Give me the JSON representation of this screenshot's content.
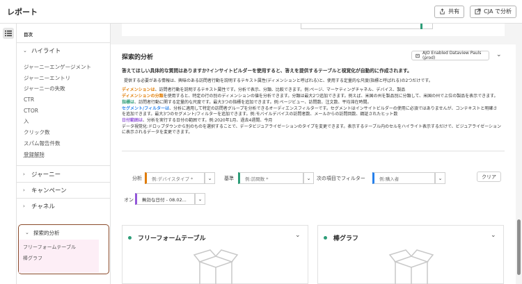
{
  "header": {
    "title": "レポート",
    "share_label": "共有",
    "cja_label": "CJA で分析"
  },
  "sidebar": {
    "toc": "目次",
    "groups": [
      {
        "label": "ハイライト",
        "expanded": true
      },
      {
        "label": "ジャーニー",
        "expanded": false
      },
      {
        "label": "キャンペーン",
        "expanded": false
      },
      {
        "label": "チャネル",
        "expanded": false
      },
      {
        "label": "探索的分析",
        "expanded": true
      }
    ],
    "highlight_items": [
      "ジャーニーエンゲージメント",
      "ジャーニーエントリ",
      "ジャーニーの失敗",
      "CTR",
      "CTOR",
      "入",
      "クリック数",
      "スパム報告件数",
      "登録解除"
    ],
    "exploratory_items": [
      "フリーフォームテーブル",
      "棒グラフ"
    ]
  },
  "section": {
    "title": "探索的分析",
    "dataview_label": "AJO Enabled Dataview Pauls (prod)",
    "question": "答えてほしい具体的な質問はありますか?インサイトビルダーを使用すると、答えを提供するテーブルと視覚化が自動的に作成されます。",
    "intro": "提供する必要がある情報は、興味のある訪問者行動を説明するテキスト属性(ディメンションと呼ばれる)と、使用する定量的な尺度(指標と呼ばれる)の2つだけです。",
    "lines": [
      {
        "term": "ディメンションは",
        "rest": "、訪問者行動を説明するテキスト属性です。分析で表示、分類、比較できます。例:ページ、マーケティングチャネル、デバイス、製品",
        "color": "orange"
      },
      {
        "term": "ディメンションの分類",
        "rest": "を使用すると、特定の行の別のディメンションの値を分析できます。分類は最大2つ追加できます。例えば、米国の州を製品別に分類して、米国の州で上位の製品を表示できます。",
        "color": "orange"
      },
      {
        "term": "指標は",
        "rest": "、訪問者行動に関する定量的な尺度です。最大3つの指標を追加できます。例:ページビュー、訪問数、注文数、平均滞在時間。",
        "color": "green"
      },
      {
        "term": "セグメント/フィルターは",
        "rest": "、分析に適用して特定の訪問者グループを分析できるオーディエンスフィルターです。セグメントはインサイトビルダーの使用に必須ではありませんが、コンテキストと明確さを追加できます。最大3つのセグメント/フィルターを追加できます。例:モバイルデバイスの訪問者数、メールからの訪問回数、鋼証されたヒット数",
        "color": "blue"
      },
      {
        "term": "日付範囲は",
        "rest": "、分析を実行する日付の範囲です。例:2020年1月、過去4週間、今月",
        "color": "purple"
      },
      {
        "term": "",
        "rest": "データ視覚化:ドロップダウンから別のものを選択することで、データビジュアライゼーションのタイプを変更できます。表示するテーブル内のセルをハイライト表示するだけで、ビジュアライゼーションに表示されるデータを変更できます。",
        "color": ""
      }
    ]
  },
  "filters": {
    "analyze_label": "分析",
    "analyze_placeholder": "例:デバイスタイプ *",
    "by_label": "基準",
    "by_placeholder": "例:訪問数 *",
    "filter_label": "次の項目でフィルター",
    "filter_placeholder": "例:購入者",
    "clear_label": "クリア",
    "on_label": "オン",
    "date_value": "無効な日付 - 08.02..."
  },
  "cards": [
    {
      "title": "フリーフォームテーブル"
    },
    {
      "title": "棒グラフ"
    }
  ],
  "colors": {
    "orange": "#e07b00",
    "green": "#2d9d78",
    "blue": "#2680eb",
    "purple": "#9256d9",
    "highlight_border": "#8a4a2a",
    "highlight_fill": "#fdeef6"
  }
}
